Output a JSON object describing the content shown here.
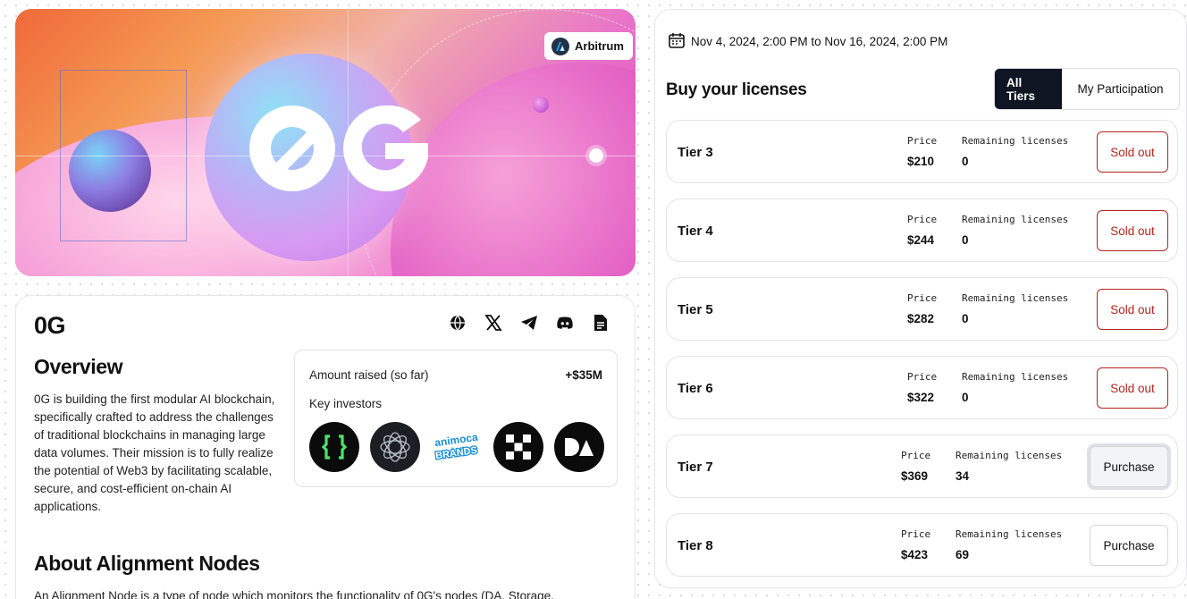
{
  "hero": {
    "chain_label": "Arbitrum"
  },
  "project": {
    "name": "0G",
    "socials": [
      "globe-icon",
      "x-icon",
      "telegram-icon",
      "discord-icon",
      "document-icon"
    ],
    "overview_title": "Overview",
    "overview_text": "0G is building the first modular AI blockchain, specifically crafted to address the challenges of traditional blockchains in managing large data volumes. Their mission is to fully realize the potential of Web3 by facilitating scalable, secure, and cost-efficient on-chain AI applications.",
    "about_title": "About Alignment Nodes",
    "about_text": "An Alignment Node is a type of node which monitors the functionality of 0G's nodes (DA, Storage,"
  },
  "funding": {
    "raised_label": "Amount raised (so far)",
    "raised_value": "+$35M",
    "investors_label": "Key investors",
    "animoca_line1": "animoca",
    "animoca_line2": "BRANDS"
  },
  "licenses": {
    "date_range": "Nov 4, 2024, 2:00 PM to Nov 16, 2024, 2:00 PM",
    "title": "Buy your licenses",
    "tabs": [
      "All Tiers",
      "My Participation"
    ],
    "price_label": "Price",
    "remaining_label": "Remaining licenses",
    "tiers": [
      {
        "name": "Tier 3",
        "price": "$210",
        "remaining": "0",
        "action": "Sold out"
      },
      {
        "name": "Tier 4",
        "price": "$244",
        "remaining": "0",
        "action": "Sold out"
      },
      {
        "name": "Tier 5",
        "price": "$282",
        "remaining": "0",
        "action": "Sold out"
      },
      {
        "name": "Tier 6",
        "price": "$322",
        "remaining": "0",
        "action": "Sold out"
      },
      {
        "name": "Tier 7",
        "price": "$369",
        "remaining": "34",
        "action": "Purchase"
      },
      {
        "name": "Tier 8",
        "price": "$423",
        "remaining": "69",
        "action": "Purchase"
      }
    ]
  },
  "colors": {
    "sold_out": "#b3261e",
    "active_tab": "#0f1523"
  }
}
